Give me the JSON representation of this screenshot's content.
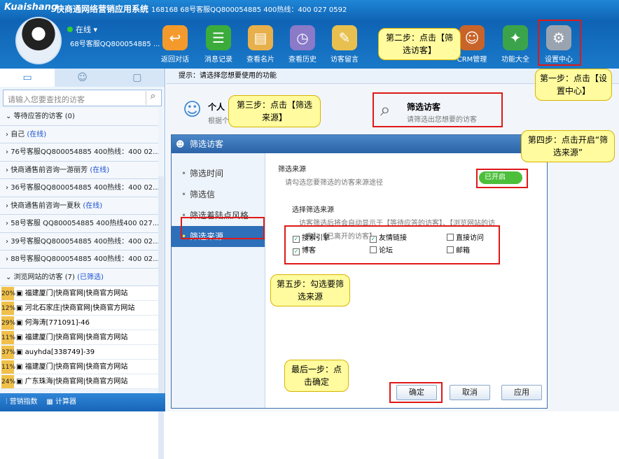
{
  "app": {
    "logo": "Kuaishang",
    "name": "快商通网络营销应用系统",
    "title_info": "168168 68号客服QQ800054885  400热线：400 027 0592"
  },
  "user": {
    "status": "在线",
    "name": "68号客服QQ800054885 ..."
  },
  "toolbar": [
    {
      "label": "返回对话"
    },
    {
      "label": "消息记录"
    },
    {
      "label": "查看名片"
    },
    {
      "label": "查看历史"
    },
    {
      "label": "访客留言"
    },
    {
      "label": "CRM管理"
    },
    {
      "label": "功能大全"
    },
    {
      "label": "设置中心"
    }
  ],
  "sidebar": {
    "search_placeholder": "请输入您要查找的访客",
    "rows": [
      {
        "text": "等待应答的访客 (0)"
      },
      {
        "text": "自己",
        "tag": "(在线)"
      },
      {
        "text": "76号客服QQ800054885  400热线：400 02..."
      },
      {
        "text": "快商通售前咨询一游丽芳",
        "tag": "(在线)"
      },
      {
        "text": "36号客服QQ800054885  400热线：400 02..."
      },
      {
        "text": "快商通售前咨询一夏秋",
        "tag": "(在线)"
      },
      {
        "text": "58号客服 QQ800054885  400热线400 027..."
      },
      {
        "text": "39号客服QQ800054885  400热线：400 02..."
      },
      {
        "text": "88号客服QQ800054885  400热线：400 02..."
      },
      {
        "text": "浏览网站的访客 (7)",
        "tag": "(已筛选)"
      }
    ],
    "visitors": [
      {
        "pct": "20%",
        "text": "福建厦门|快商官网|快商官方网站"
      },
      {
        "pct": "12%",
        "text": "河北石家庄|快商官网|快商官方网站"
      },
      {
        "pct": "29%",
        "text": "何海涛[771091]-46"
      },
      {
        "pct": "11%",
        "text": "福建厦门|快商官网|快商官方网站"
      },
      {
        "pct": "37%",
        "text": "auyhda[338749]-39"
      },
      {
        "pct": "11%",
        "text": "福建厦门|快商官网|快商官方网站"
      },
      {
        "pct": "24%",
        "text": "广东珠海|快商官网|快商官方网站"
      }
    ],
    "bottom": [
      "营销指数",
      "计算器"
    ]
  },
  "main": {
    "hint": "提示：请选择您想要使用的功能",
    "card_personal_title": "个人",
    "card_personal_desc": "根据个",
    "card_filter_title": "筛选访客",
    "card_filter_desc": "请筛选出您想要的访客"
  },
  "dialog": {
    "title": "筛选访客",
    "menu": [
      "筛选时间",
      "筛选信",
      "筛选着陆点风格",
      "筛选来源"
    ],
    "section": "筛选来源",
    "section_desc": "请勾选您要筛选的访客来源途径",
    "toggle": "已开启",
    "choose_title": "选择筛选来源",
    "choose_desc1": "访客筛选后将会自动显示于【等待应答的访客】、【浏览网站的访",
    "choose_desc2": "客】、【已离开的访客】",
    "options": [
      {
        "label": "搜索引擎",
        "checked": true
      },
      {
        "label": "友情链接",
        "checked": true
      },
      {
        "label": "直接访问",
        "checked": false
      },
      {
        "label": "博客",
        "checked": true
      },
      {
        "label": "论坛",
        "checked": false
      },
      {
        "label": "邮箱",
        "checked": false
      }
    ],
    "buttons": {
      "ok": "确定",
      "cancel": "取消",
      "apply": "应用"
    }
  },
  "callouts": {
    "step1": "第一步：点击【设置中心】",
    "step2": "第二步：点击【筛选访客】",
    "step3": "第三步：点击【筛选来源】",
    "step4": "第四步：点击开启“筛选来源”",
    "step5": "第五步：勾选要筛选来源",
    "last": "最后一步：点击确定"
  }
}
